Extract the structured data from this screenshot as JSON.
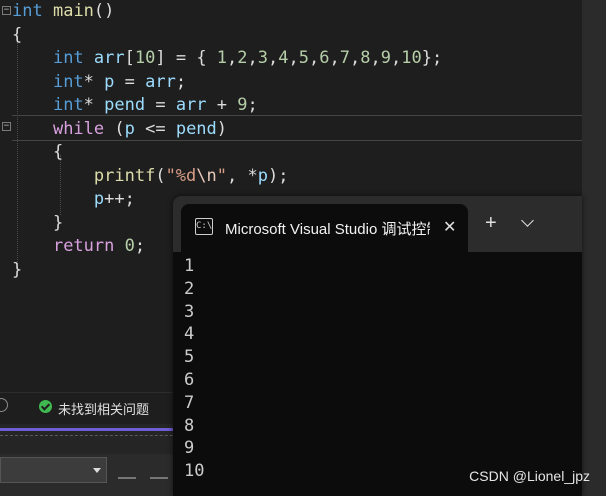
{
  "editor": {
    "lines": [
      [
        {
          "t": "int",
          "c": "kw"
        },
        {
          "t": " "
        },
        {
          "t": "main",
          "c": "fn"
        },
        {
          "t": "()"
        }
      ],
      [
        {
          "t": "{"
        }
      ],
      [
        {
          "t": "    "
        },
        {
          "t": "int",
          "c": "kw"
        },
        {
          "t": " "
        },
        {
          "t": "arr",
          "c": "var"
        },
        {
          "t": "["
        },
        {
          "t": "10",
          "c": "num"
        },
        {
          "t": "] = { "
        },
        {
          "t": "1",
          "c": "num"
        },
        {
          "t": ","
        },
        {
          "t": "2",
          "c": "num"
        },
        {
          "t": ","
        },
        {
          "t": "3",
          "c": "num"
        },
        {
          "t": ","
        },
        {
          "t": "4",
          "c": "num"
        },
        {
          "t": ","
        },
        {
          "t": "5",
          "c": "num"
        },
        {
          "t": ","
        },
        {
          "t": "6",
          "c": "num"
        },
        {
          "t": ","
        },
        {
          "t": "7",
          "c": "num"
        },
        {
          "t": ","
        },
        {
          "t": "8",
          "c": "num"
        },
        {
          "t": ","
        },
        {
          "t": "9",
          "c": "num"
        },
        {
          "t": ","
        },
        {
          "t": "10",
          "c": "num"
        },
        {
          "t": "};"
        }
      ],
      [
        {
          "t": "    "
        },
        {
          "t": "int",
          "c": "kw"
        },
        {
          "t": "* "
        },
        {
          "t": "p",
          "c": "var"
        },
        {
          "t": " = "
        },
        {
          "t": "arr",
          "c": "var"
        },
        {
          "t": ";"
        }
      ],
      [
        {
          "t": "    "
        },
        {
          "t": "int",
          "c": "kw"
        },
        {
          "t": "* "
        },
        {
          "t": "pend",
          "c": "var"
        },
        {
          "t": " = "
        },
        {
          "t": "arr",
          "c": "var"
        },
        {
          "t": " + "
        },
        {
          "t": "9",
          "c": "num"
        },
        {
          "t": ";"
        }
      ],
      [
        {
          "t": "    "
        },
        {
          "t": "while",
          "c": "ctl"
        },
        {
          "t": " ("
        },
        {
          "t": "p",
          "c": "var"
        },
        {
          "t": " <= "
        },
        {
          "t": "pend",
          "c": "var"
        },
        {
          "t": ")"
        }
      ],
      [
        {
          "t": "    {"
        }
      ],
      [
        {
          "t": "        "
        },
        {
          "t": "printf",
          "c": "fn"
        },
        {
          "t": "("
        },
        {
          "t": "\"%d",
          "c": "str"
        },
        {
          "t": "\\n",
          "c": "esc"
        },
        {
          "t": "\"",
          "c": "str"
        },
        {
          "t": ", *"
        },
        {
          "t": "p",
          "c": "var"
        },
        {
          "t": ");"
        }
      ],
      [
        {
          "t": "        "
        },
        {
          "t": "p",
          "c": "var"
        },
        {
          "t": "++;"
        }
      ],
      [
        {
          "t": "    }"
        }
      ],
      [
        {
          "t": "    "
        },
        {
          "t": "return",
          "c": "ctl"
        },
        {
          "t": " "
        },
        {
          "t": "0",
          "c": "num"
        },
        {
          "t": ";"
        }
      ],
      [
        {
          "t": "}"
        }
      ]
    ]
  },
  "status": {
    "text": "未找到相关问题"
  },
  "terminal": {
    "tab_title": "Microsoft Visual Studio 调试控制台",
    "close_glyph": "✕",
    "new_tab_glyph": "+",
    "icon_text": "C:\\",
    "output": [
      "1",
      "2",
      "3",
      "4",
      "5",
      "6",
      "7",
      "8",
      "9",
      "10"
    ]
  },
  "watermark": "CSDN @Lionel_jpz",
  "colors": {
    "keyword": "#569cd6",
    "function": "#dcdcaa",
    "number": "#b5cea8",
    "string": "#d69d85",
    "control": "#d8a0df",
    "variable": "#9cdcfe",
    "terminal_bg": "#0c0c0c",
    "accent": "#6f5dd6"
  },
  "icons": [
    "fold-icon",
    "help-icon",
    "check-icon",
    "cmd-icon",
    "close-icon",
    "plus-icon",
    "chevron-down-icon"
  ]
}
